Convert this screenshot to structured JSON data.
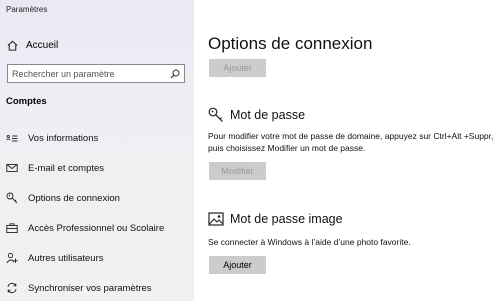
{
  "app": {
    "title": "Paramètres"
  },
  "sidebar": {
    "home_label": "Accueil",
    "search_placeholder": "Rechercher un paramètre",
    "section_label": "Comptes",
    "items": [
      {
        "label": "Vos informations",
        "icon": "person-card-icon"
      },
      {
        "label": "E-mail et comptes",
        "icon": "mail-icon"
      },
      {
        "label": "Options de connexion",
        "icon": "key-icon"
      },
      {
        "label": "Accès Professionnel ou Scolaire",
        "icon": "briefcase-icon"
      },
      {
        "label": "Autres utilisateurs",
        "icon": "add-person-icon"
      },
      {
        "label": "Synchroniser vos paramètres",
        "icon": "sync-icon"
      }
    ]
  },
  "main": {
    "title": "Options de connexion",
    "top_button": "Ajouter",
    "password": {
      "heading": "Mot de passe",
      "description": "Pour modifier votre mot de passe de domaine, appuyez sur Ctrl+Alt +Suppr, puis choisissez Modifier un mot de passe.",
      "button": "Modifier"
    },
    "picture_password": {
      "heading": "Mot de passe image",
      "description": "Se connecter à Windows à l’aide d’une photo favorite.",
      "button": "Ajouter"
    }
  }
}
